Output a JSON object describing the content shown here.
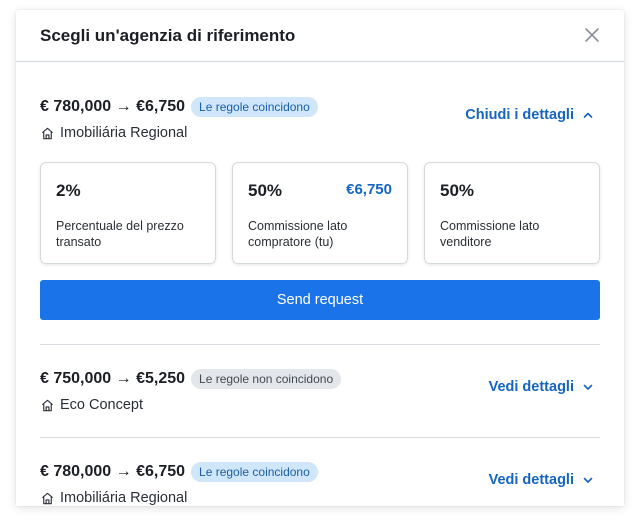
{
  "modal": {
    "title": "Scegli un'agenzia di riferimento",
    "close_icon": "close-icon"
  },
  "offers": [
    {
      "price": "€ 780,000 → €6,750",
      "badge": "Le regole coincidono",
      "badge_type": "match",
      "agency": "Imobiliária Regional",
      "toggle": "Chiudi i dettagli",
      "expanded": true,
      "details": [
        {
          "value": "2%",
          "extra": "",
          "label": "Percentuale del prezzo transato"
        },
        {
          "value": "50%",
          "extra": "€6,750",
          "label": "Commissione lato compratore (tu)"
        },
        {
          "value": "50%",
          "extra": "",
          "label": "Commissione lato venditore"
        }
      ],
      "action": "Send request"
    },
    {
      "price": "€ 750,000 → €5,250",
      "badge": "Le regole non coincidono",
      "badge_type": "nomatch",
      "agency": "Eco Concept",
      "toggle": "Vedi dettagli",
      "expanded": false
    },
    {
      "price": "€ 780,000 → €6,750",
      "badge": "Le regole coincidono",
      "badge_type": "match",
      "agency": "Imobiliária Regional",
      "toggle": "Vedi dettagli",
      "expanded": false
    }
  ],
  "colors": {
    "accent": "#1a73e8",
    "link": "#1565c0",
    "match_badge_bg": "#cfe6fb",
    "nomatch_badge_bg": "#e3e6ea"
  }
}
